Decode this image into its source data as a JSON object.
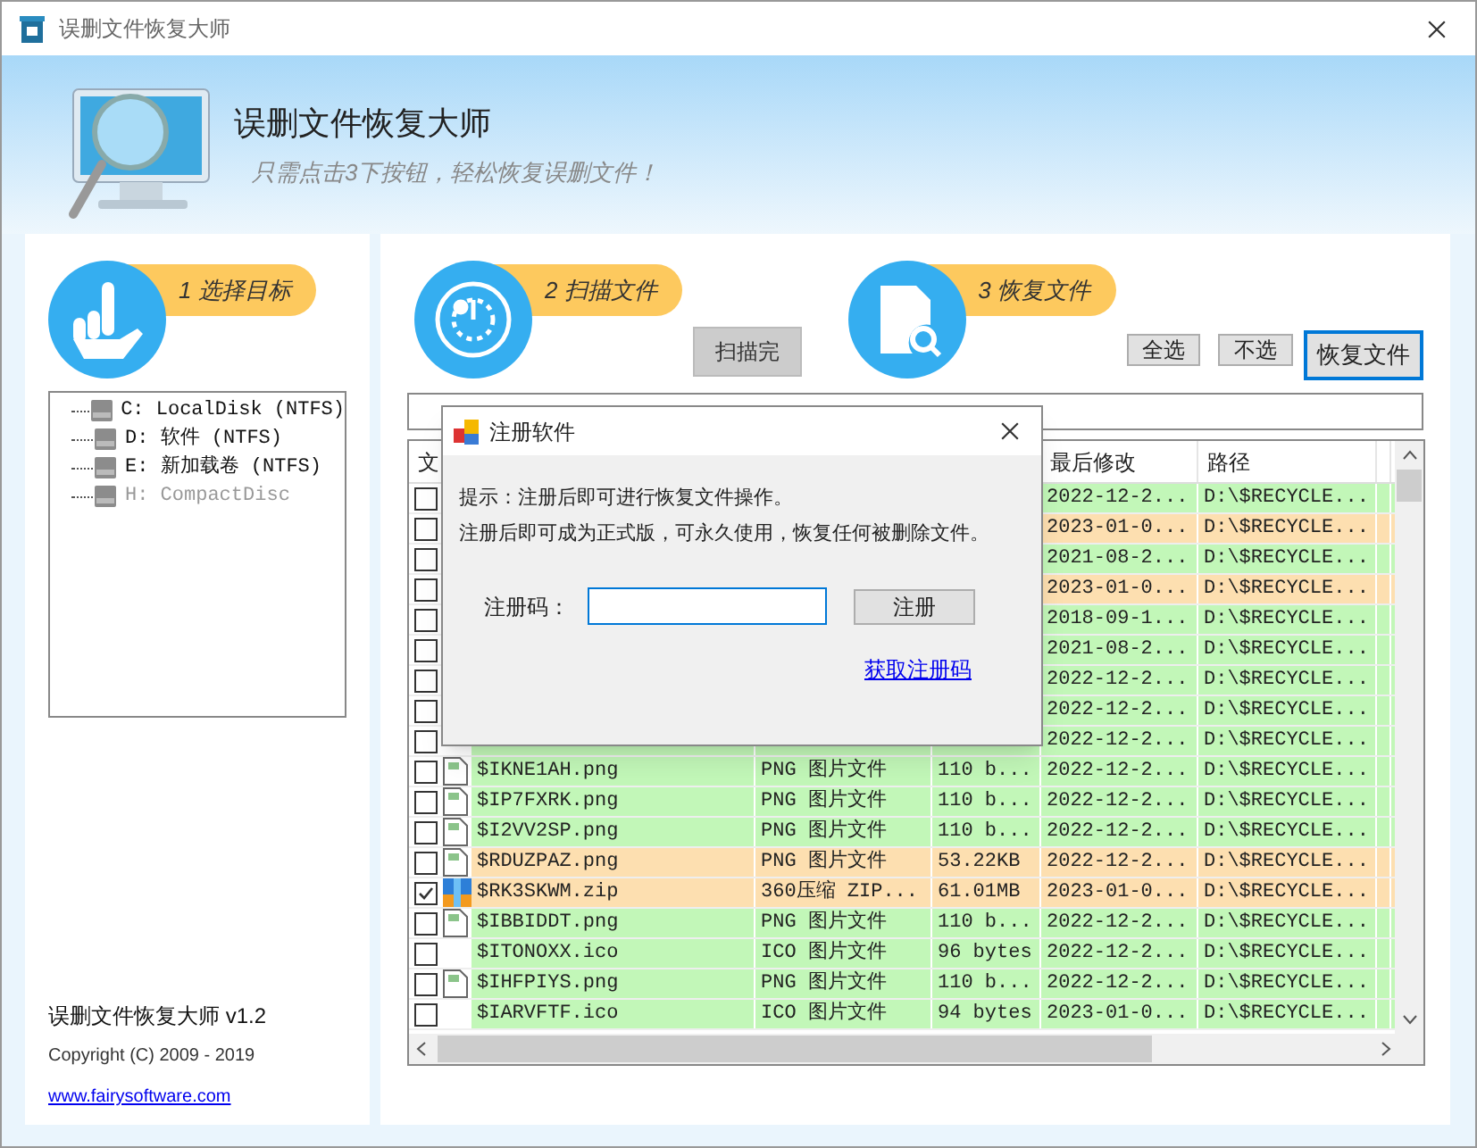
{
  "window": {
    "title": "误删文件恢复大师"
  },
  "header": {
    "title": "误删文件恢复大师",
    "subtitle": "只需点击3下按钮，轻松恢复误删文件！"
  },
  "steps": [
    {
      "label": "1 选择目标",
      "kind": "hand"
    },
    {
      "label": "2 扫描文件",
      "kind": "radar"
    },
    {
      "label": "3 恢复文件",
      "kind": "document"
    }
  ],
  "drives": [
    {
      "label": "C: LocalDisk (NTFS)",
      "disabled": false
    },
    {
      "label": "D: 软件 (NTFS)",
      "disabled": false
    },
    {
      "label": "E: 新加载卷 (NTFS)",
      "disabled": false
    },
    {
      "label": "H: CompactDisc",
      "disabled": true
    }
  ],
  "about": {
    "version": "误删文件恢复大师 v1.2",
    "copyright": "Copyright (C) 2009 - 2019",
    "link": "www.fairysoftware.com"
  },
  "scan_button": {
    "label": "扫描完",
    "disabled": true
  },
  "buttons": [
    "全选",
    "不选",
    "恢复文件"
  ],
  "table": {
    "columns": [
      {
        "label": "文"
      },
      {
        "label": "最后修改"
      },
      {
        "label": "路径"
      }
    ],
    "rows": [
      {
        "checked": false,
        "color": "#c2f7b8",
        "date": "2022-12-2...",
        "path": "D:\\$RECYCLE..."
      },
      {
        "checked": false,
        "color": "#fddfb0",
        "date": "2023-01-0...",
        "path": "D:\\$RECYCLE..."
      },
      {
        "checked": false,
        "color": "#c2f7b8",
        "date": "2021-08-2...",
        "path": "D:\\$RECYCLE..."
      },
      {
        "checked": false,
        "color": "#fddfb0",
        "date": "2023-01-0...",
        "path": "D:\\$RECYCLE..."
      },
      {
        "checked": false,
        "color": "#c2f7b8",
        "date": "2018-09-1...",
        "path": "D:\\$RECYCLE..."
      },
      {
        "checked": false,
        "color": "#c2f7b8",
        "date": "2021-08-2...",
        "path": "D:\\$RECYCLE..."
      },
      {
        "checked": false,
        "color": "#c2f7b8",
        "date": "2022-12-2...",
        "path": "D:\\$RECYCLE..."
      },
      {
        "checked": false,
        "color": "#c2f7b8",
        "date": "2022-12-2...",
        "path": "D:\\$RECYCLE..."
      },
      {
        "checked": false,
        "color": "#c2f7b8",
        "date": "2022-12-2...",
        "path": "D:\\$RECYCLE..."
      },
      {
        "checked": false,
        "color": "#c2f7b8",
        "kind": "image",
        "name": "$IKNE1AH.png",
        "type": "PNG 图片文件",
        "size": "110 b...",
        "date": "2022-12-2...",
        "path": "D:\\$RECYCLE..."
      },
      {
        "checked": false,
        "color": "#c2f7b8",
        "kind": "image",
        "name": "$IP7FXRK.png",
        "type": "PNG 图片文件",
        "size": "110 b...",
        "date": "2022-12-2...",
        "path": "D:\\$RECYCLE..."
      },
      {
        "checked": false,
        "color": "#c2f7b8",
        "kind": "image",
        "name": "$I2VV2SP.png",
        "type": "PNG 图片文件",
        "size": "110 b...",
        "date": "2022-12-2...",
        "path": "D:\\$RECYCLE..."
      },
      {
        "checked": false,
        "color": "#fddfb0",
        "kind": "image",
        "name": "$RDUZPAZ.png",
        "type": "PNG 图片文件",
        "size": "53.22KB",
        "date": "2022-12-2...",
        "path": "D:\\$RECYCLE..."
      },
      {
        "checked": true,
        "color": "#fddfb0",
        "kind": "archive",
        "name": "$RK3SKWM.zip",
        "type": "360压缩 ZIP...",
        "size": "61.01MB",
        "date": "2023-01-0...",
        "path": "D:\\$RECYCLE..."
      },
      {
        "checked": false,
        "color": "#c2f7b8",
        "kind": "image",
        "name": "$IBBIDDT.png",
        "type": "PNG 图片文件",
        "size": "110 b...",
        "date": "2022-12-2...",
        "path": "D:\\$RECYCLE..."
      },
      {
        "checked": false,
        "color": "#c2f7b8",
        "kind": "none",
        "name": "$ITONOXX.ico",
        "type": "ICO 图片文件",
        "size": "96 bytes",
        "date": "2022-12-2...",
        "path": "D:\\$RECYCLE..."
      },
      {
        "checked": false,
        "color": "#c2f7b8",
        "kind": "image",
        "name": "$IHFPIYS.png",
        "type": "PNG 图片文件",
        "size": "110 b...",
        "date": "2022-12-2...",
        "path": "D:\\$RECYCLE..."
      },
      {
        "checked": false,
        "color": "#c2f7b8",
        "kind": "none",
        "name": "$IARVFTF.ico",
        "type": "ICO 图片文件",
        "size": "94 bytes",
        "date": "2023-01-0...",
        "path": "D:\\$RECYCLE..."
      }
    ]
  },
  "dialog": {
    "title": "注册软件",
    "lines": [
      "提示：注册后即可进行恢复文件操作。",
      "注册后即可成为正式版，可永久使用，恢复任何被删除文件。"
    ],
    "field_label": "注册码：",
    "button": "注册",
    "link": "获取注册码"
  }
}
